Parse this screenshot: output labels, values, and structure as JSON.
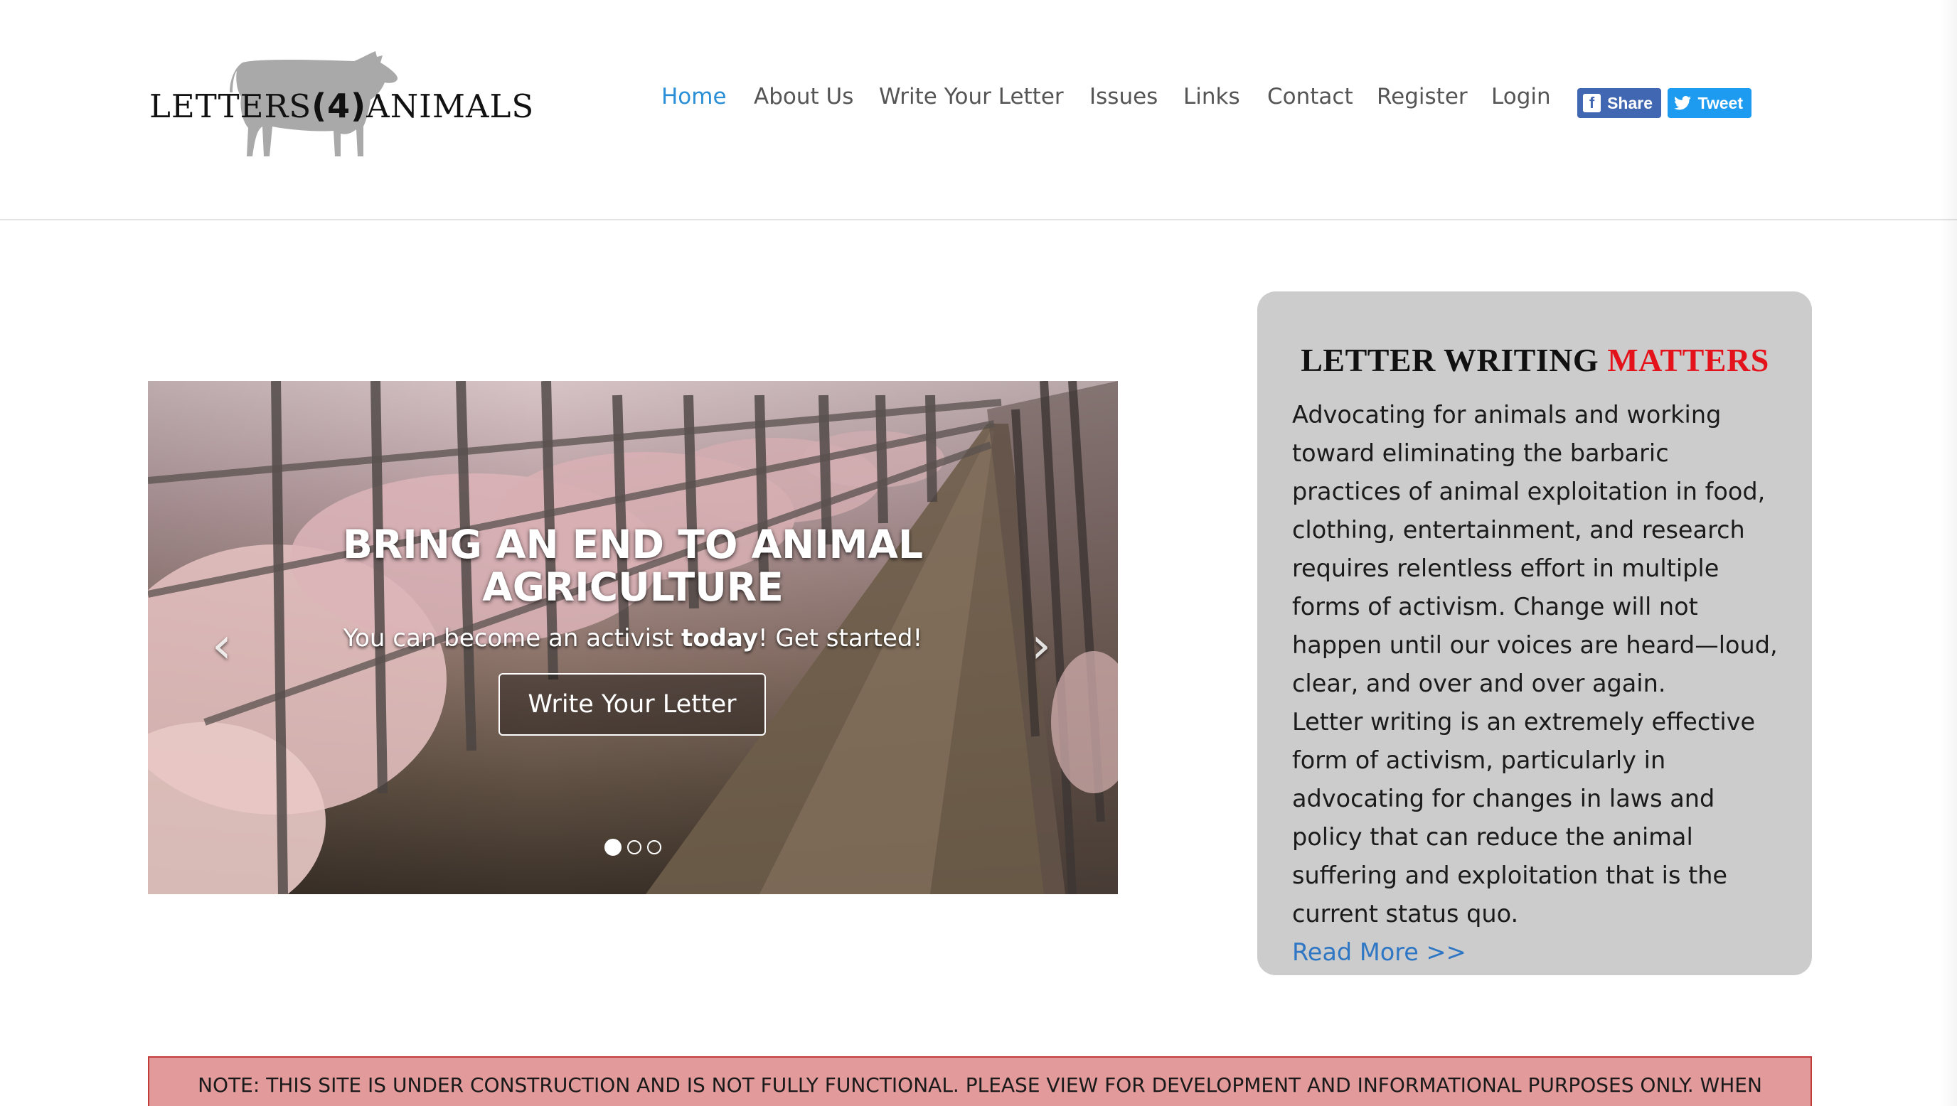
{
  "logo": {
    "text_left": "LETTERS",
    "text_num": "(4)",
    "text_right": "ANIMALS"
  },
  "nav": {
    "items": [
      {
        "label": "Home",
        "active": true
      },
      {
        "label": "About Us"
      },
      {
        "label": "Write Your Letter"
      },
      {
        "label": "Issues"
      },
      {
        "label": "Links"
      },
      {
        "label": "Contact"
      },
      {
        "label": "Register"
      },
      {
        "label": "Login"
      }
    ],
    "share_label": "Share",
    "tweet_label": "Tweet"
  },
  "hero": {
    "title_line1": "BRING AN END TO ANIMAL",
    "title_line2": "AGRICULTURE",
    "sub_before": "You can become an activist ",
    "sub_bold": "today",
    "sub_after": "! Get started!",
    "button_label": "Write Your Letter",
    "prev_arrow": "‹",
    "next_arrow": "›",
    "slide_count": 3,
    "active_slide": 1
  },
  "info": {
    "title_black": "LETTER WRITING ",
    "title_red": "MATTERS",
    "paragraph1": "Advocating for animals and working toward eliminating the barbaric practices of animal exploitation in food, clothing, entertainment, and research requires relentless effort in multiple forms of activism. Change will not happen until our voices are heard—loud, clear, and over and over again.",
    "paragraph2": "Letter writing is an extremely effective form of activism, particularly in advocating for changes in laws and policy that can reduce the animal suffering and exploitation that is the current status quo.",
    "read_more": "Read More >>"
  },
  "note": {
    "text": "NOTE: THIS SITE IS UNDER CONSTRUCTION AND IS NOT FULLY FUNCTIONAL. PLEASE VIEW FOR DEVELOPMENT AND INFORMATIONAL PURPOSES ONLY. WHEN"
  },
  "colors": {
    "nav_active": "#2a8fd6",
    "facebook": "#4267b2",
    "twitter": "#1d9bf0",
    "accent_red": "#e4121b",
    "link_blue": "#2f77c4",
    "note_bg": "#e29a9b"
  },
  "icons": {
    "logo_graphic": "cow-silhouette-icon",
    "share_icon": "facebook-icon",
    "tweet_icon": "twitter-bird-icon"
  }
}
